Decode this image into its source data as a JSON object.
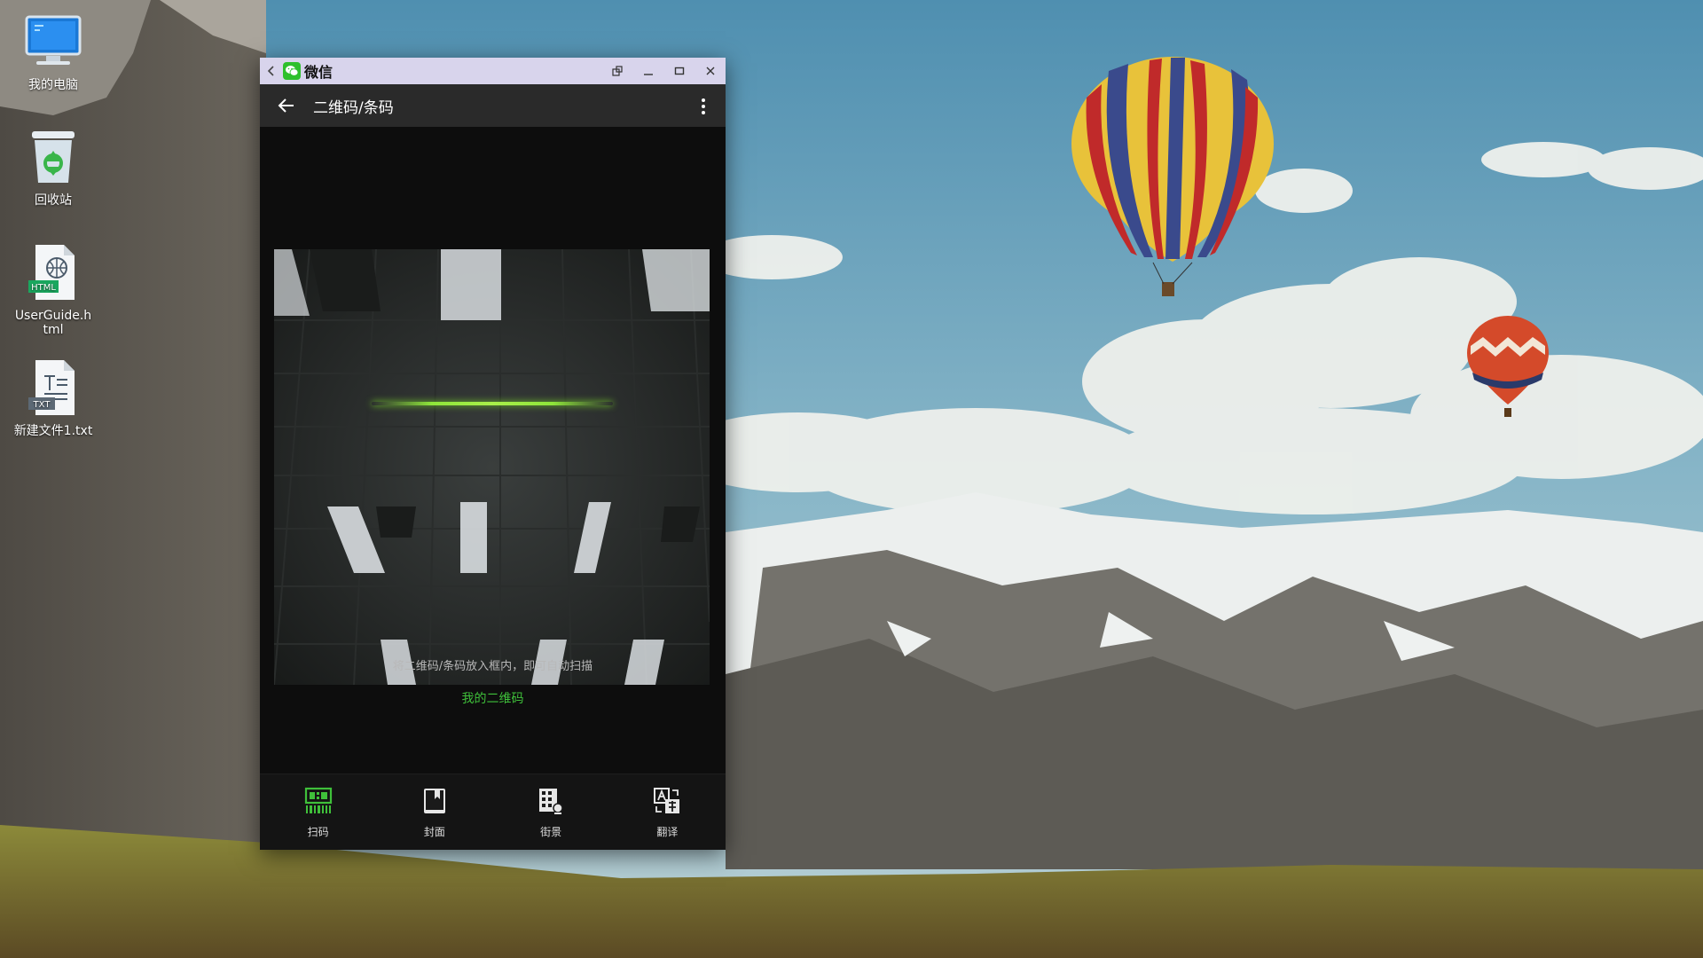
{
  "desktop": {
    "icons": [
      {
        "label": "我的电脑",
        "icon": "computer-icon"
      },
      {
        "label": "回收站",
        "icon": "recycle-bin-icon"
      },
      {
        "label": "UserGuide.html",
        "icon": "html-file-icon",
        "badge": "HTML"
      },
      {
        "label": "新建文件1.txt",
        "icon": "txt-file-icon",
        "badge": "TXT"
      }
    ]
  },
  "window": {
    "app_title": "微信",
    "icons": {
      "back": "back-arrow-icon",
      "pin": "pin-icon",
      "minimize": "minimize-icon",
      "maximize": "maximize-icon",
      "close": "close-icon"
    }
  },
  "scanner": {
    "title": "二维码/条码",
    "hint": "将二维码/条码放入框内，即可自动扫描",
    "my_code_link": "我的二维码",
    "accent_color": "#3fc03a"
  },
  "bottom_nav": [
    {
      "label": "扫码",
      "icon": "scan-code-icon",
      "active": true
    },
    {
      "label": "封面",
      "icon": "book-cover-icon",
      "active": false
    },
    {
      "label": "街景",
      "icon": "street-view-icon",
      "active": false
    },
    {
      "label": "翻译",
      "icon": "translate-icon",
      "active": false
    }
  ]
}
